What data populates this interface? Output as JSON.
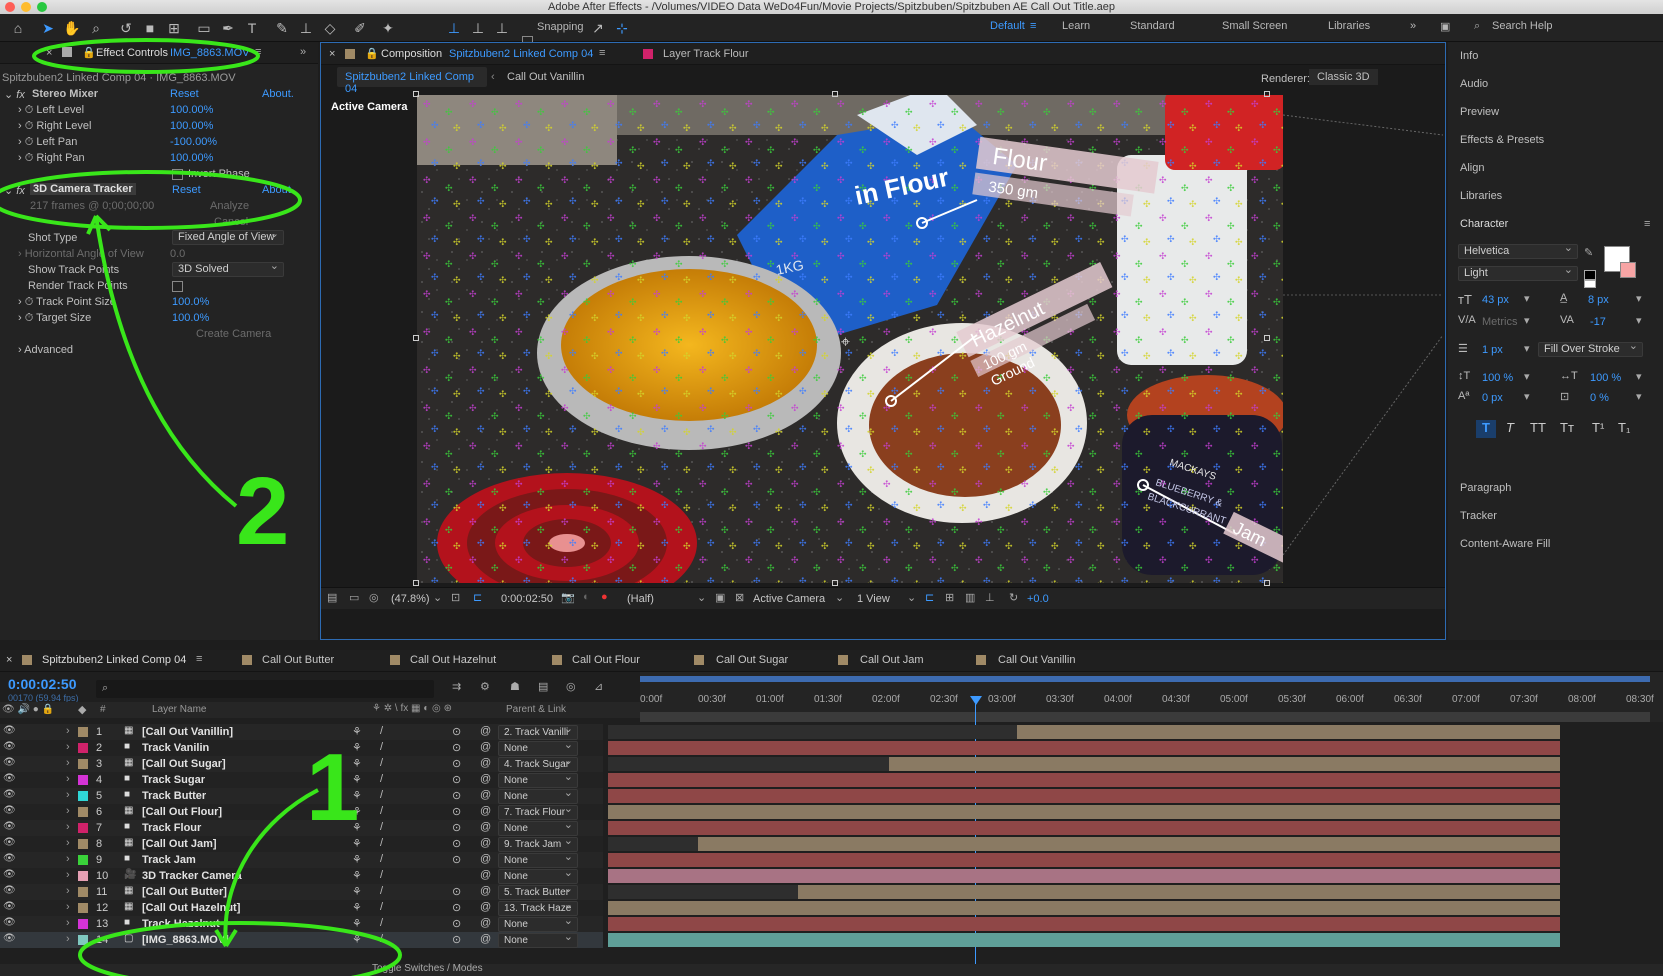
{
  "app": {
    "title": "Adobe After Effects - /Volumes/VIDEO Data WeDo4Fun/Movie Projects/Spitzbuben/Spitzbuben AE Call Out Title.aep"
  },
  "toolbar": {
    "snapping": "Snapping",
    "workspaces": [
      "Default",
      "Learn",
      "Standard",
      "Small Screen",
      "Libraries"
    ],
    "search": "Search Help"
  },
  "effect_controls": {
    "tab": "Effect Controls",
    "tab_file": "IMG_8863.MOV",
    "breadcrumb": "Spitzbuben2 Linked Comp 04 · IMG_8863.MOV",
    "stereo": {
      "name": "Stereo Mixer",
      "reset": "Reset",
      "about": "About.",
      "props": [
        {
          "name": "Left Level",
          "value": "100.00%"
        },
        {
          "name": "Right Level",
          "value": "100.00%"
        },
        {
          "name": "Left Pan",
          "value": "-100.00%"
        },
        {
          "name": "Right Pan",
          "value": "100.00%"
        }
      ],
      "invert": "Invert Phase"
    },
    "tracker": {
      "name": "3D Camera Tracker",
      "reset": "Reset",
      "about": "About",
      "status": "217 frames @ 0;00;00;00",
      "analyze": "Analyze",
      "cancel": "Cancel",
      "shot_type_label": "Shot Type",
      "shot_type": "Fixed Angle of View",
      "hfov_label": "Horizontal Angle of View",
      "hfov": "0.0",
      "show_tp_label": "Show Track Points",
      "show_tp": "3D Solved",
      "render_tp": "Render Track Points",
      "tp_size_label": "Track Point Size",
      "tp_size": "100.0%",
      "target_label": "Target Size",
      "target": "100.0%",
      "create_camera": "Create Camera",
      "advanced": "Advanced"
    }
  },
  "composition": {
    "tab_label": "Composition",
    "tab_name": "Spitzbuben2 Linked Comp 04",
    "layer_tab": "Layer Track Flour",
    "sub_tabs": [
      "Spitzbuben2 Linked Comp 04",
      "Call Out Vanillin"
    ],
    "renderer_label": "Renderer:",
    "renderer": "Classic 3D",
    "camera_label": "Active Camera",
    "labels": {
      "flour": "Flour",
      "flour_sub": "350 gm",
      "hazel": "Hazelnut",
      "hazel_sub1": "100 gm",
      "hazel_sub2": "Ground",
      "jam": "Jam",
      "bag1": "in Flour",
      "bag2": "1KG",
      "jar1": "BLUEBERRY &",
      "jar2": "BLACKCURRANT",
      "jar3": "MACKAYS"
    },
    "footer": {
      "zoom": "(47.8%)",
      "time": "0:00:02:50",
      "resolution": "(Half)",
      "view": "Active Camera",
      "views": "1 View",
      "exposure": "+0.0"
    }
  },
  "right_panel": {
    "items": [
      "Info",
      "Audio",
      "Preview",
      "Effects & Presets",
      "Align",
      "Libraries",
      "Character",
      "Paragraph",
      "Tracker",
      "Content-Aware Fill"
    ],
    "character": {
      "font": "Helvetica",
      "style": "Light",
      "size": "43 px",
      "leading": "8 px",
      "kerning": "Metrics",
      "tracking": "-17",
      "stroke_width": "1 px",
      "stroke_type": "Fill Over Stroke",
      "vscale": "100 %",
      "hscale": "100 %",
      "baseline": "0 px",
      "tsume": "0 %",
      "fill_color": "#ffffff",
      "stroke_color": "#ff3030"
    }
  },
  "timeline": {
    "tabs": [
      "Spitzbuben2 Linked Comp 04",
      "Call Out Butter",
      "Call Out Hazelnut",
      "Call Out Flour",
      "Call Out Sugar",
      "Call Out Jam",
      "Call Out Vanillin"
    ],
    "timecode": "0:00:02:50",
    "frames": "00170 (59.94 fps)",
    "col_layer": "Layer Name",
    "col_parent": "Parent & Link",
    "col_num": "#",
    "ruler": [
      "0:00f",
      "00:30f",
      "01:00f",
      "01:30f",
      "02:00f",
      "02:30f",
      "03:00f",
      "03:30f",
      "04:00f",
      "04:30f",
      "05:00f",
      "05:30f",
      "06:00f",
      "06:30f",
      "07:00f",
      "07:30f",
      "08:00f",
      "08:30f"
    ],
    "toggle": "Toggle Switches / Modes",
    "layers": [
      {
        "num": "1",
        "name": "[Call Out Vanillin]",
        "color": "#a08a66",
        "icon": "comp",
        "parent": "2. Track Vanilli",
        "start": 0.43,
        "bar": "#8a7a63"
      },
      {
        "num": "2",
        "name": "Track Vanilin",
        "color": "#d0226a",
        "icon": "solid",
        "parent": "None",
        "start": 0,
        "bar": "#8f4747"
      },
      {
        "num": "3",
        "name": "[Call Out Sugar]",
        "color": "#a08a66",
        "icon": "comp",
        "parent": "4. Track Sugar",
        "start": 0.295,
        "bar": "#8a7a63"
      },
      {
        "num": "4",
        "name": "Track Sugar",
        "color": "#d433d6",
        "icon": "solid",
        "parent": "None",
        "start": 0,
        "bar": "#8f4747"
      },
      {
        "num": "5",
        "name": "Track Butter",
        "color": "#2fd6d6",
        "icon": "solid",
        "parent": "None",
        "start": 0,
        "bar": "#8f4747"
      },
      {
        "num": "6",
        "name": "[Call Out Flour]",
        "color": "#a08a66",
        "icon": "comp",
        "parent": "7. Track Flour",
        "start": 0.0,
        "bar": "#8a7a63"
      },
      {
        "num": "7",
        "name": "Track Flour",
        "color": "#d0226a",
        "icon": "solid",
        "parent": "None",
        "start": 0,
        "bar": "#8f4747"
      },
      {
        "num": "8",
        "name": "[Call Out Jam]",
        "color": "#a08a66",
        "icon": "comp",
        "parent": "9. Track Jam",
        "start": 0.095,
        "bar": "#8a7a63"
      },
      {
        "num": "9",
        "name": "Track Jam",
        "color": "#3ad23a",
        "icon": "solid",
        "parent": "None",
        "start": 0,
        "bar": "#8f4747"
      },
      {
        "num": "10",
        "name": "3D Tracker Camera",
        "color": "#e6a0b4",
        "icon": "camera",
        "parent": "None",
        "start": 0,
        "bar": "#a87384"
      },
      {
        "num": "11",
        "name": "[Call Out Butter]",
        "color": "#a08a66",
        "icon": "comp",
        "parent": "5. Track Butter",
        "start": 0.2,
        "bar": "#8a7a63"
      },
      {
        "num": "12",
        "name": "[Call Out Hazelnut]",
        "color": "#a08a66",
        "icon": "comp",
        "parent": "13. Track Haze",
        "start": 0.0,
        "bar": "#8a7a63"
      },
      {
        "num": "13",
        "name": "Track Hazelnut",
        "color": "#d433d6",
        "icon": "solid",
        "parent": "None",
        "start": 0,
        "bar": "#8f4747"
      },
      {
        "num": "14",
        "name": "[IMG_8863.MOV]",
        "color": "#7fc8c0",
        "icon": "footage",
        "parent": "None",
        "start": 0,
        "bar": "#5f9f98"
      }
    ]
  },
  "annotations": {
    "step1": "1",
    "step2": "2"
  }
}
